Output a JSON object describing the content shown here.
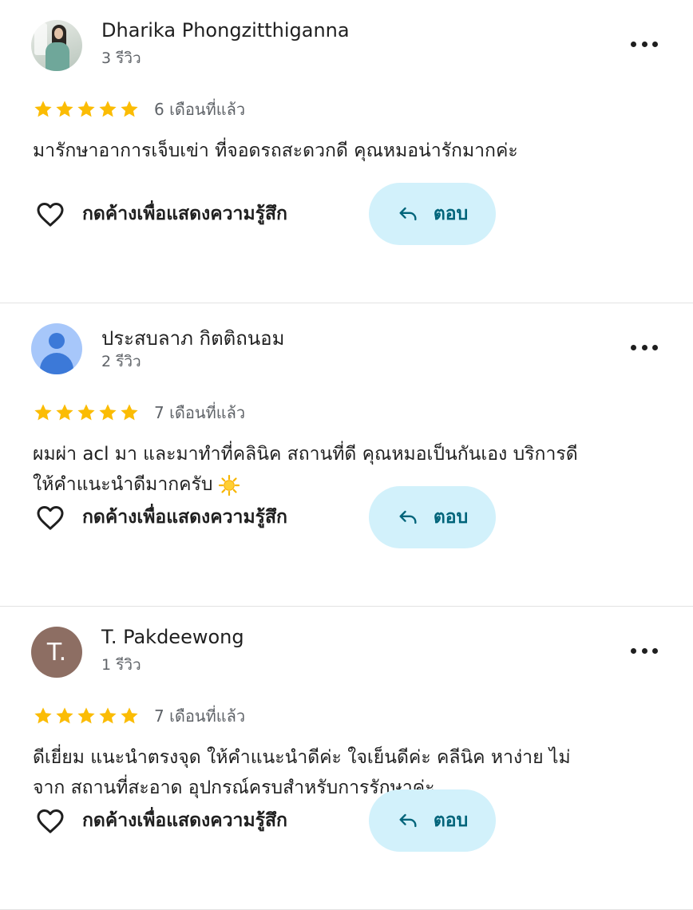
{
  "reviews": [
    {
      "name": "Dharika Phongzitthiganna",
      "review_count": "3 รีวิว",
      "rating": 5,
      "date": "6 เดือนที่แล้ว",
      "text_lines": [
        "มารักษาอาการเจ็บเข่า ที่จอดรถสะดวกดี คุณหมอน่ารักมากค่ะ"
      ],
      "avatar": "photo",
      "like_label": "กดค้างเพื่อแสดงความรู้สึก",
      "reply_label": "ตอบ"
    },
    {
      "name": "ประสบลาภ กิตติถนอม",
      "review_count": "2 รีวิว",
      "rating": 5,
      "date": "7 เดือนที่แล้ว",
      "text_lines": [
        "ผมผ่า acl มา และมาทำที่คลินิค สถานที่ดี คุณหมอเป็นกันเอง บริการดี",
        "ให้คำแนะนำดีมากครับ"
      ],
      "text_emoji": "sun-emoji",
      "avatar": "default-person",
      "like_label": "กดค้างเพื่อแสดงความรู้สึก",
      "reply_label": "ตอบ"
    },
    {
      "name": "T. Pakdeewong",
      "review_count": "1 รีวิว",
      "rating": 5,
      "date": "7 เดือนที่แล้ว",
      "text_lines": [
        "ดีเยี่ยม แนะนำตรงจุด ให้คำแนะนำดีค่ะ ใจเย็นดีค่ะ คลีนิค หาง่าย ไม่",
        "จาก สถานที่สะอาด อุปกรณ์ครบสำหรับการรักษาค่ะ"
      ],
      "avatar": "letter",
      "avatar_letter": "T.",
      "avatar_color": "#8d6e63",
      "like_label": "กดค้างเพื่อแสดงความรู้สึก",
      "reply_label": "ตอบ"
    }
  ],
  "colors": {
    "star": "#fbbc04",
    "reply_bg": "#d2f1fb",
    "reply_text": "#00647a",
    "secondary_text": "#5f6368"
  },
  "icons": {
    "like": "heart-outline-icon",
    "reply": "reply-arrow-icon",
    "more": "more-horizontal-icon",
    "star": "star-icon"
  }
}
